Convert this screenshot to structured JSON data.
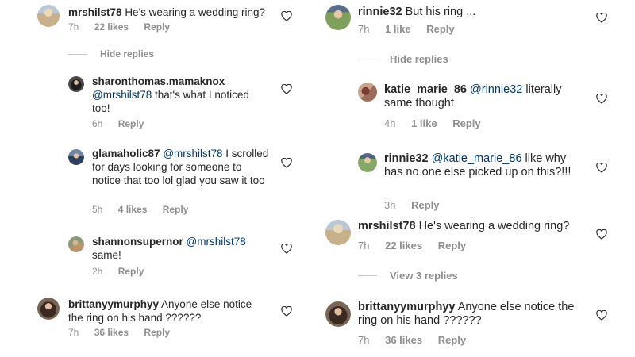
{
  "left": {
    "c1": {
      "username": "mrshilst78",
      "text": "He's wearing a wedding ring?",
      "time": "7h",
      "likes": "22 likes",
      "reply": "Reply"
    },
    "hide_replies": "Hide replies",
    "r1": {
      "username": "sharonthomas.mamaknox",
      "mention": "@mrshilst78",
      "text": " that's what I noticed too!",
      "time": "6h",
      "reply": "Reply"
    },
    "r2": {
      "username": "glamaholic87",
      "mention": "@mrshilst78",
      "text": " I scrolled for days looking for someone to notice that too lol glad you saw it too",
      "time": "5h",
      "likes": "4 likes",
      "reply": "Reply"
    },
    "r3": {
      "username": "shannonsupernor",
      "mention": "@mrshilst78",
      "text": "same!",
      "time": "2h",
      "reply": "Reply"
    },
    "c2": {
      "username": "brittanyymurphyy",
      "text": "Anyone else notice the ring on his hand ??????",
      "time": "7h",
      "likes": "36 likes",
      "reply": "Reply"
    }
  },
  "right": {
    "c1": {
      "username": "rinnie32",
      "text": "But his ring ...",
      "time": "7h",
      "likes": "1 like",
      "reply": "Reply"
    },
    "hide_replies": "Hide replies",
    "r1": {
      "username": "katie_marie_86",
      "mention": "@rinnie32",
      "text": " literally same thought",
      "time": "4h",
      "likes": "1 like",
      "reply": "Reply"
    },
    "r2": {
      "username": "rinnie32",
      "mention": "@katie_marie_86",
      "text": " like why has no one else picked up on this?!!!",
      "time": "3h",
      "reply": "Reply"
    },
    "c2": {
      "username": "mrshilst78",
      "text": "He's wearing a wedding ring?",
      "time": "7h",
      "likes": "22 likes",
      "reply": "Reply"
    },
    "view_replies": "View 3 replies",
    "c3": {
      "username": "brittanyymurphyy",
      "text": "Anyone else notice the ring on his hand ??????",
      "time": "7h",
      "likes": "36 likes",
      "reply": "Reply"
    }
  }
}
